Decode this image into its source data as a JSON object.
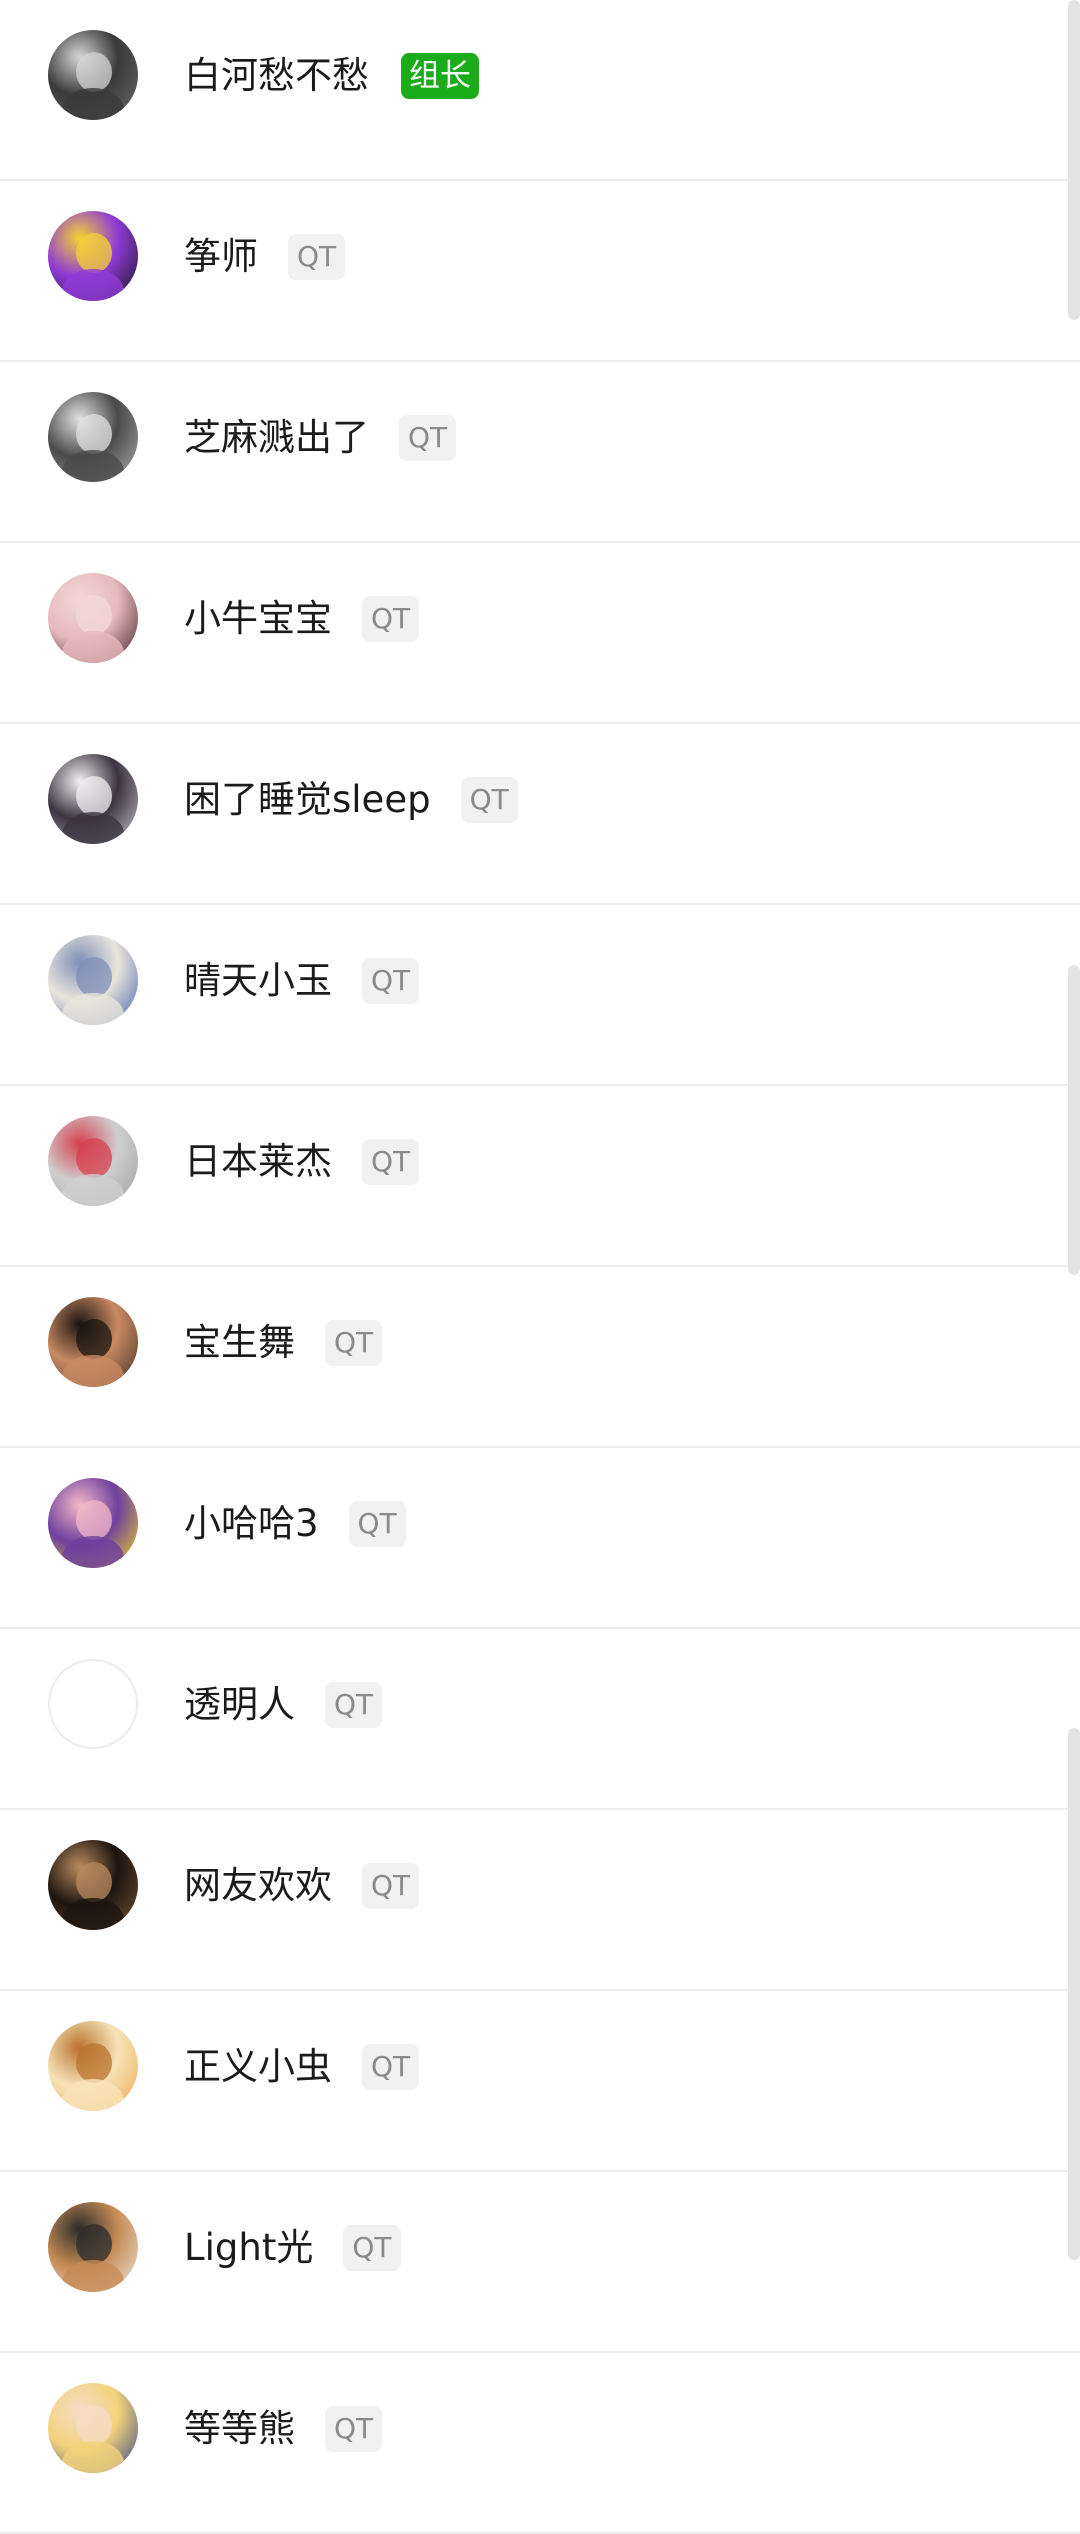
{
  "members": [
    {
      "name": "白河愁不愁",
      "badge": "组长",
      "badge_type": "leader",
      "avatar_icon": "avatar-photo-icon",
      "avatar_colors": [
        "#6d6d6d",
        "#3a3a3a",
        "#d6d6d6"
      ]
    },
    {
      "name": "筝师",
      "badge": "QT",
      "badge_type": "tag",
      "avatar_icon": "avatar-cartoon-icon",
      "avatar_colors": [
        "#111111",
        "#8e3bd6",
        "#f5d234"
      ]
    },
    {
      "name": "芝麻溅出了",
      "badge": "QT",
      "badge_type": "tag",
      "avatar_icon": "avatar-photo-icon",
      "avatar_colors": [
        "#b5b5b5",
        "#4a4a4a",
        "#e2e2e2"
      ]
    },
    {
      "name": "小牛宝宝",
      "badge": "QT",
      "badge_type": "tag",
      "avatar_icon": "avatar-photo-icon",
      "avatar_colors": [
        "#3a1a22",
        "#e7b9bd",
        "#f3d9d6"
      ]
    },
    {
      "name": "困了睡觉sleep",
      "badge": "QT",
      "badge_type": "tag",
      "avatar_icon": "avatar-photo-icon",
      "avatar_colors": [
        "#cfcbd4",
        "#3b3440",
        "#f2eef0"
      ]
    },
    {
      "name": "晴天小玉",
      "badge": "QT",
      "badge_type": "tag",
      "avatar_icon": "avatar-photo-icon",
      "avatar_colors": [
        "#3f5aa8",
        "#e9e5dc",
        "#7f8fb8"
      ]
    },
    {
      "name": "日本莱杰",
      "badge": "QT",
      "badge_type": "tag",
      "avatar_icon": "avatar-photo-icon",
      "avatar_colors": [
        "#9c9c9c",
        "#cfcfcf",
        "#d6404f"
      ]
    },
    {
      "name": "宝生舞",
      "badge": "QT",
      "badge_type": "tag",
      "avatar_icon": "avatar-photo-icon",
      "avatar_colors": [
        "#3b2a22",
        "#c98a63",
        "#1a1410"
      ]
    },
    {
      "name": "小哈哈3",
      "badge": "QT",
      "badge_type": "tag",
      "avatar_icon": "avatar-cartoon-icon",
      "avatar_colors": [
        "#f6e21c",
        "#6e3f9e",
        "#f3b9c7"
      ]
    },
    {
      "name": "透明人",
      "badge": "QT",
      "badge_type": "tag",
      "avatar_icon": "avatar-blank-icon",
      "avatar_colors": [
        "#ffffff",
        "#ffffff",
        "#ffffff"
      ]
    },
    {
      "name": "网友欢欢",
      "badge": "QT",
      "badge_type": "tag",
      "avatar_icon": "avatar-dog-icon",
      "avatar_colors": [
        "#7a5332",
        "#1c140f",
        "#b98b5f"
      ]
    },
    {
      "name": "正义小虫",
      "badge": "QT",
      "badge_type": "tag",
      "avatar_icon": "avatar-cartoon-icon",
      "avatar_colors": [
        "#eaa84b",
        "#f7e3b8",
        "#b9732e"
      ]
    },
    {
      "name": "Light光",
      "badge": "QT",
      "badge_type": "tag",
      "avatar_icon": "avatar-cat-icon",
      "avatar_colors": [
        "#f2ede6",
        "#c58b55",
        "#2b2b2b"
      ]
    },
    {
      "name": "等等熊",
      "badge": "QT",
      "badge_type": "tag",
      "avatar_icon": "avatar-anime-icon",
      "avatar_colors": [
        "#2d3f8a",
        "#f3d37a",
        "#f6dcc8"
      ]
    }
  ],
  "colors": {
    "leader_badge_bg": "#1aad19",
    "tag_badge_bg": "#f1f1f1",
    "divider": "#ececec"
  }
}
